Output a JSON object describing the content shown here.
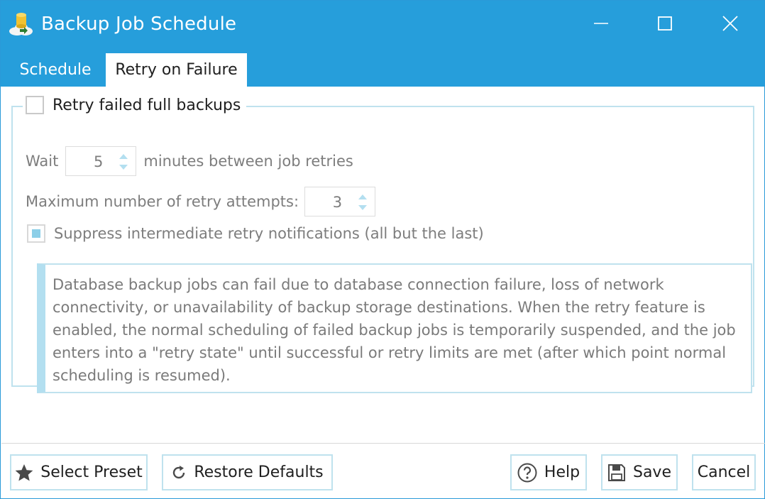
{
  "window": {
    "title": "Backup Job Schedule",
    "app_icon": "database-backup-icon",
    "controls": [
      "minimize-icon",
      "maximize-icon",
      "close-icon"
    ]
  },
  "tabs": [
    {
      "label": "Schedule",
      "active": false
    },
    {
      "label": "Retry on Failure",
      "active": true
    }
  ],
  "retry": {
    "enable_label": "Retry failed full backups",
    "enable_checked": false,
    "wait_prefix": "Wait",
    "wait_value": "5",
    "wait_suffix": "minutes between job retries",
    "max_attempts_label": "Maximum number of retry attempts:",
    "max_attempts_value": "3",
    "suppress_label": "Suppress intermediate retry notifications (all but the last)",
    "suppress_checked": true,
    "info": "Database backup jobs can fail due to database connection failure, loss of network connectivity, or unavailability of backup storage destinations. When the retry feature is enabled, the normal scheduling of failed backup jobs is temporarily suspended, and the job enters into a \"retry state\" until successful or retry limits are met (after which point normal scheduling is resumed)."
  },
  "footer": {
    "select_preset": "Select Preset",
    "restore_defaults": "Restore Defaults",
    "help": "Help",
    "save": "Save",
    "cancel": "Cancel"
  },
  "colors": {
    "title_bar": "#269edb",
    "accent_border": "#bfe2ee",
    "info_stripe": "#b3dff0"
  }
}
